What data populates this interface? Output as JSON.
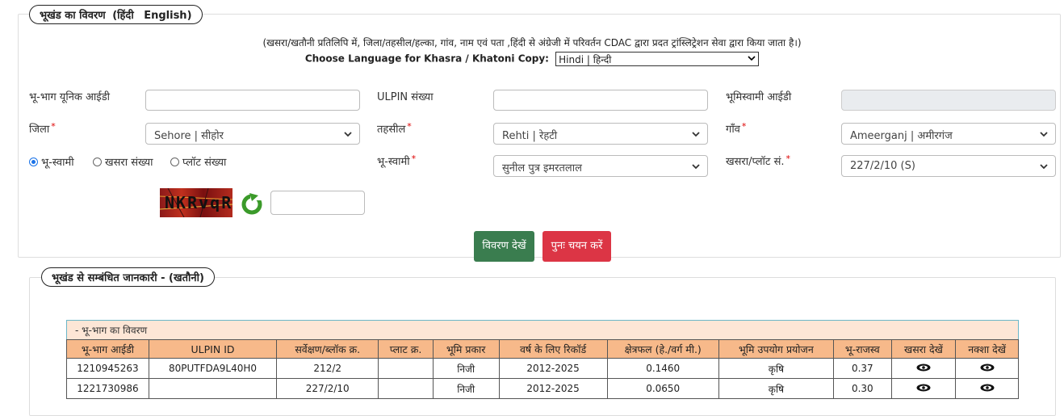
{
  "section1": {
    "legend_title": "भूखंड का विवरण",
    "legend_hindi": "(हिंदी",
    "legend_english": "English)",
    "note": "(खसरा/खतौनी प्रतिलिपि में, जिला/तहसील/हल्का, गांव, नाम एवं पता ,हिंदी से अंग्रेजी में परिवर्तन CDAC द्वारा प्रदत ट्रांस्लिट्रेशन सेवा द्वारा किया जाता है।)",
    "language_label": "Choose Language for Khasra / Khatoni Copy:",
    "language_value": "Hindi | हिन्दी"
  },
  "form": {
    "land_unique_id_label": "भू-भाग यूनिक आईडी",
    "land_unique_id_value": "",
    "ulpin_label": "ULPIN संख्या",
    "ulpin_value": "",
    "owner_id_label": "भूमिस्वामी आईडी",
    "owner_id_value": "",
    "district_label": "जिला",
    "district_value": "Sehore | सीहोर",
    "tehsil_label": "तहसील",
    "tehsil_value": "Rehti | रेहटी",
    "village_label": "गाँव",
    "village_value": "Ameerganj | अमीरगंज",
    "radio_owner": "भू-स्वामी",
    "radio_khasra": "खसरा संख्या",
    "radio_plot": "प्लॉट संख्या",
    "owner_label": "भू-स्वामी",
    "owner_value": "सुनील पुत्र इमरतलाल",
    "khasra_label": "खसरा/प्लॉट सं.",
    "khasra_value": "227/2/10 (S)",
    "captcha_text": "NKRvqR",
    "captcha_input": "",
    "view_button": "विवरण देखें",
    "reset_button": "पुनः चयन करें"
  },
  "section2": {
    "legend_title": "भूखंड से सम्बंधित जानकारी -   (खतौनी)"
  },
  "table": {
    "caption": "- भू-भाग का विवरण",
    "headers": [
      "भू-भाग आईडी",
      "ULPIN ID",
      "सर्वेक्षण/ब्लॉक क्र.",
      "प्लाट क्र.",
      "भूमि प्रकार",
      "वर्ष के लिए रिकॉर्ड",
      "क्षेत्रफल (हे./वर्ग मी.)",
      "भूमि उपयोग प्रयोजन",
      "भू-राजस्व",
      "खसरा देखें",
      "नक्शा देखें"
    ],
    "rows": [
      [
        "1210945263",
        "80PUTFDA9L40H0",
        "212/2",
        "",
        "निजी",
        "2012-2025",
        "0.1460",
        "कृषि",
        "0.37"
      ],
      [
        "1221730986",
        "",
        "227/2/10",
        "",
        "निजी",
        "2012-2025",
        "0.0650",
        "कृषि",
        "0.30"
      ]
    ]
  },
  "colors": {
    "header_bg": "#f7b98a",
    "caption_bg": "#fde6d6",
    "view_button": "#3a7d4f",
    "reset_button": "#dc3545"
  }
}
